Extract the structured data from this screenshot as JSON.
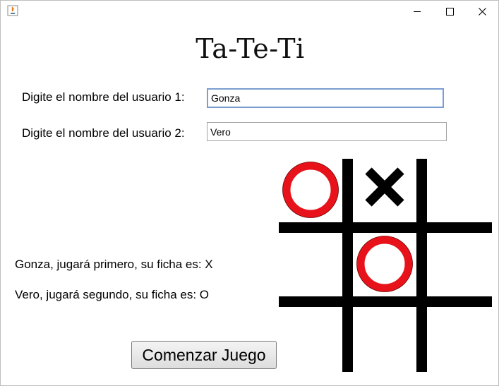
{
  "window": {
    "controls": [
      "minimize",
      "maximize",
      "close"
    ]
  },
  "title": "Ta-Te-Ti",
  "form": {
    "user1_label": "Digite el nombre del usuario 1:",
    "user1_value": "Gonza",
    "user2_label": "Digite el nombre del usuario 2:",
    "user2_value": "Vero"
  },
  "info": {
    "first_player": "Gonza, jugará primero, su ficha es: X",
    "second_player": "Vero, jugará segundo, su ficha es: O"
  },
  "start_button_label": "Comenzar Juego",
  "board": {
    "cells": [
      "O",
      "X",
      "",
      "",
      "O",
      "",
      "",
      "",
      ""
    ],
    "colors": {
      "o": "#e8131a",
      "x": "#000000",
      "grid": "#000000"
    }
  }
}
